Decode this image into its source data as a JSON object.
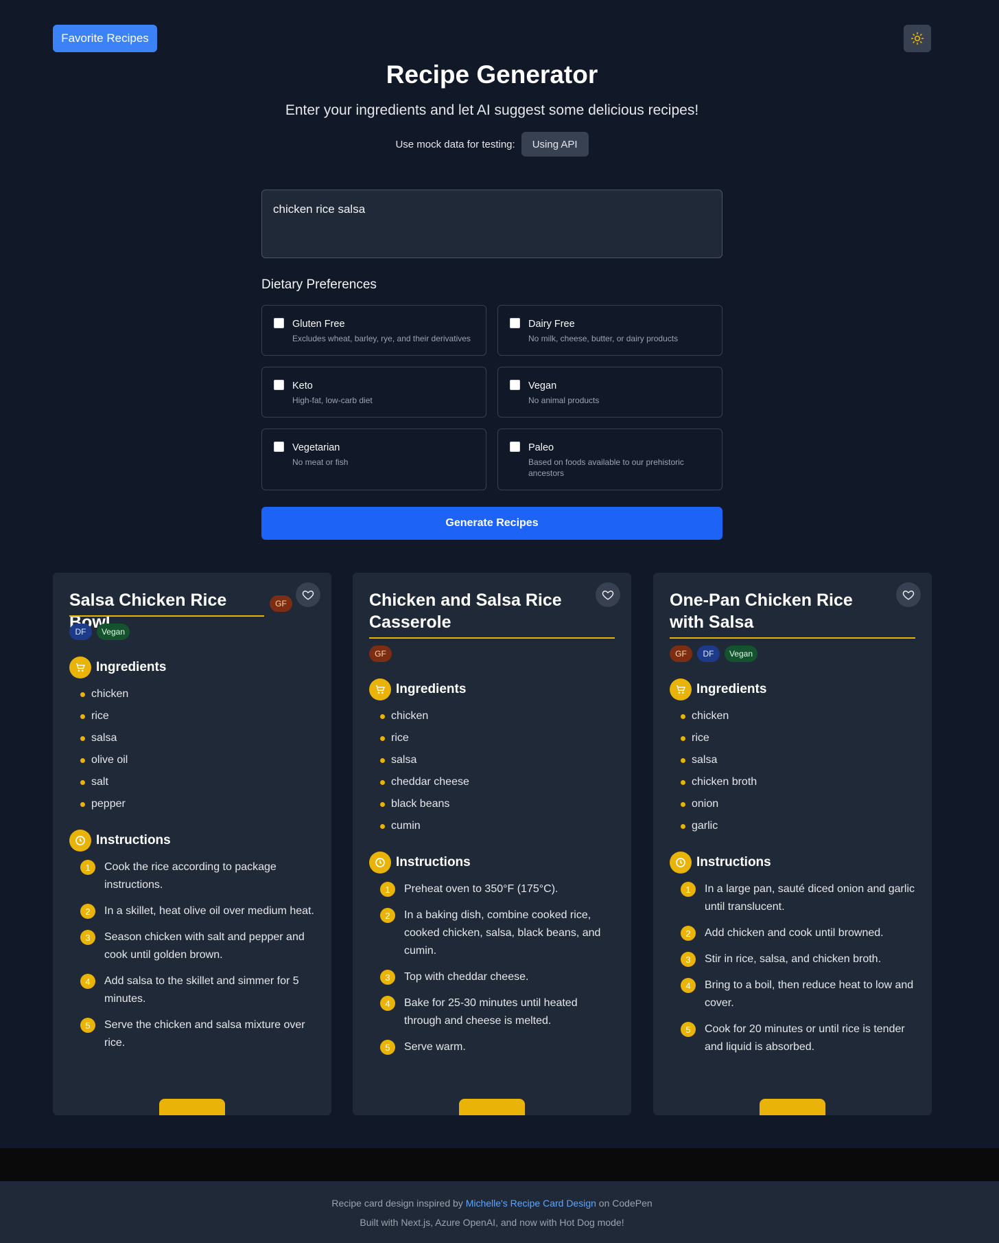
{
  "header": {
    "favorites_label": "Favorite Recipes",
    "theme_icon": "sun-icon",
    "title": "Recipe Generator",
    "subtitle": "Enter your ingredients and let AI suggest some delicious recipes!",
    "mock_label": "Use mock data for testing:",
    "mock_button": "Using API"
  },
  "form": {
    "ingredients_value": "chicken rice salsa",
    "dietary_heading": "Dietary Preferences",
    "preferences": [
      {
        "name": "Gluten Free",
        "desc": "Excludes wheat, barley, rye, and their derivatives",
        "checked": false
      },
      {
        "name": "Dairy Free",
        "desc": "No milk, cheese, butter, or dairy products",
        "checked": false
      },
      {
        "name": "Keto",
        "desc": "High-fat, low-carb diet",
        "checked": false
      },
      {
        "name": "Vegan",
        "desc": "No animal products",
        "checked": false
      },
      {
        "name": "Vegetarian",
        "desc": "No meat or fish",
        "checked": false
      },
      {
        "name": "Paleo",
        "desc": "Based on foods available to our prehistoric ancestors",
        "checked": false
      }
    ],
    "generate_label": "Generate Recipes"
  },
  "recipes": [
    {
      "title": "Salsa Chicken Rice Bowl",
      "badges": [
        "GF",
        "DF",
        "Vegan"
      ],
      "ingredients_heading": "Ingredients",
      "ingredients": [
        "chicken",
        "rice",
        "salsa",
        "olive oil",
        "salt",
        "pepper"
      ],
      "instructions_heading": "Instructions",
      "steps": [
        "Cook the rice according to package instructions.",
        "In a skillet, heat olive oil over medium heat.",
        "Season chicken with salt and pepper and cook until golden brown.",
        "Add salsa to the skillet and simmer for 5 minutes.",
        "Serve the chicken and salsa mixture over rice."
      ]
    },
    {
      "title": "Chicken and Salsa Rice Casserole",
      "badges": [
        "GF"
      ],
      "ingredients_heading": "Ingredients",
      "ingredients": [
        "chicken",
        "rice",
        "salsa",
        "cheddar cheese",
        "black beans",
        "cumin"
      ],
      "instructions_heading": "Instructions",
      "steps": [
        "Preheat oven to 350°F (175°C).",
        "In a baking dish, combine cooked rice, cooked chicken, salsa, black beans, and cumin.",
        "Top with cheddar cheese.",
        "Bake for 25-30 minutes until heated through and cheese is melted.",
        "Serve warm."
      ]
    },
    {
      "title": "One-Pan Chicken Rice with Salsa",
      "badges": [
        "GF",
        "DF",
        "Vegan"
      ],
      "ingredients_heading": "Ingredients",
      "ingredients": [
        "chicken",
        "rice",
        "salsa",
        "chicken broth",
        "onion",
        "garlic"
      ],
      "instructions_heading": "Instructions",
      "steps": [
        "In a large pan, sauté diced onion and garlic until translucent.",
        "Add chicken and cook until browned.",
        "Stir in rice, salsa, and chicken broth.",
        "Bring to a boil, then reduce heat to low and cover.",
        "Cook for 20 minutes or until rice is tender and liquid is absorbed."
      ]
    }
  ],
  "footer": {
    "line1_prefix": "Recipe card design inspired by",
    "line1_link": "Michelle's Recipe Card Design",
    "line1_suffix": "on CodePen",
    "line2": "Built with Next.js, Azure OpenAI, and now with Hot Dog mode!"
  },
  "colors": {
    "background": "#111827",
    "card": "#1f2937",
    "accent": "#eab308",
    "primary": "#1d63f5"
  }
}
